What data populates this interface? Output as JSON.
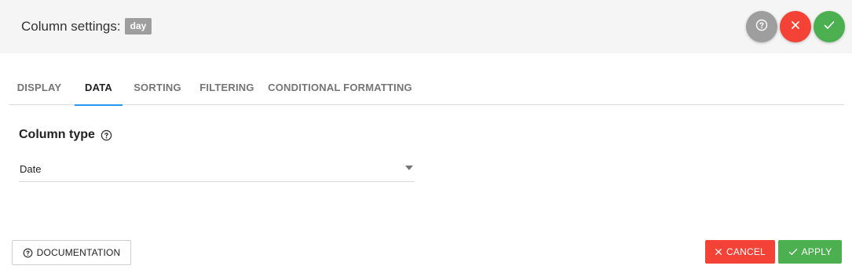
{
  "header": {
    "title": "Column settings:",
    "badge": "day",
    "buttons": {
      "help_icon": "help-circle-icon",
      "close_icon": "close-icon",
      "ok_icon": "check-icon"
    }
  },
  "tabs": [
    {
      "label": "DISPLAY",
      "active": false
    },
    {
      "label": "DATA",
      "active": true
    },
    {
      "label": "SORTING",
      "active": false
    },
    {
      "label": "FILTERING",
      "active": false
    },
    {
      "label": "CONDITIONAL FORMATTING",
      "active": false
    }
  ],
  "data_tab": {
    "section_title": "Column type",
    "column_type": {
      "selected": "Date"
    }
  },
  "footer": {
    "documentation_label": "DOCUMENTATION",
    "cancel_label": "CANCEL",
    "apply_label": "APPLY"
  },
  "colors": {
    "accent": "#2196f3",
    "danger": "#f44336",
    "success": "#4caf50",
    "neutral": "#9e9e9e",
    "header_bg": "#f5f5f5"
  }
}
